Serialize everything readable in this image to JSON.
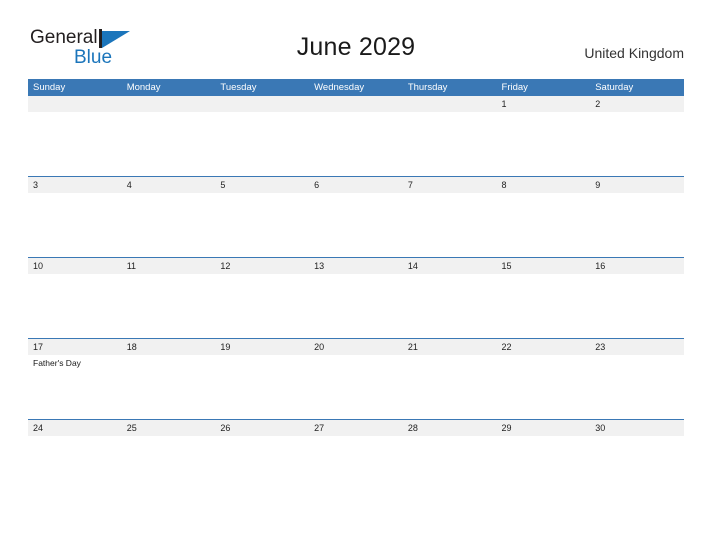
{
  "brand": {
    "name_top": "General",
    "name_bottom": "Blue",
    "flag_icon": "blue-flag-triangle",
    "primary_color": "#1b75bb"
  },
  "header": {
    "title": "June 2029",
    "region": "United Kingdom"
  },
  "colors": {
    "header_blue": "#3a78b5",
    "date_band": "#f1f1f1",
    "brand_blue": "#1b75bb",
    "text": "#222222"
  },
  "calendar": {
    "weekdays": [
      "Sunday",
      "Monday",
      "Tuesday",
      "Wednesday",
      "Thursday",
      "Friday",
      "Saturday"
    ],
    "weeks": [
      {
        "days": [
          {
            "date": "",
            "events": []
          },
          {
            "date": "",
            "events": []
          },
          {
            "date": "",
            "events": []
          },
          {
            "date": "",
            "events": []
          },
          {
            "date": "",
            "events": []
          },
          {
            "date": "1",
            "events": []
          },
          {
            "date": "2",
            "events": []
          }
        ]
      },
      {
        "days": [
          {
            "date": "3",
            "events": []
          },
          {
            "date": "4",
            "events": []
          },
          {
            "date": "5",
            "events": []
          },
          {
            "date": "6",
            "events": []
          },
          {
            "date": "7",
            "events": []
          },
          {
            "date": "8",
            "events": []
          },
          {
            "date": "9",
            "events": []
          }
        ]
      },
      {
        "days": [
          {
            "date": "10",
            "events": []
          },
          {
            "date": "11",
            "events": []
          },
          {
            "date": "12",
            "events": []
          },
          {
            "date": "13",
            "events": []
          },
          {
            "date": "14",
            "events": []
          },
          {
            "date": "15",
            "events": []
          },
          {
            "date": "16",
            "events": []
          }
        ]
      },
      {
        "days": [
          {
            "date": "17",
            "events": [
              "Father's Day"
            ]
          },
          {
            "date": "18",
            "events": []
          },
          {
            "date": "19",
            "events": []
          },
          {
            "date": "20",
            "events": []
          },
          {
            "date": "21",
            "events": []
          },
          {
            "date": "22",
            "events": []
          },
          {
            "date": "23",
            "events": []
          }
        ]
      },
      {
        "days": [
          {
            "date": "24",
            "events": []
          },
          {
            "date": "25",
            "events": []
          },
          {
            "date": "26",
            "events": []
          },
          {
            "date": "27",
            "events": []
          },
          {
            "date": "28",
            "events": []
          },
          {
            "date": "29",
            "events": []
          },
          {
            "date": "30",
            "events": []
          }
        ]
      }
    ]
  }
}
